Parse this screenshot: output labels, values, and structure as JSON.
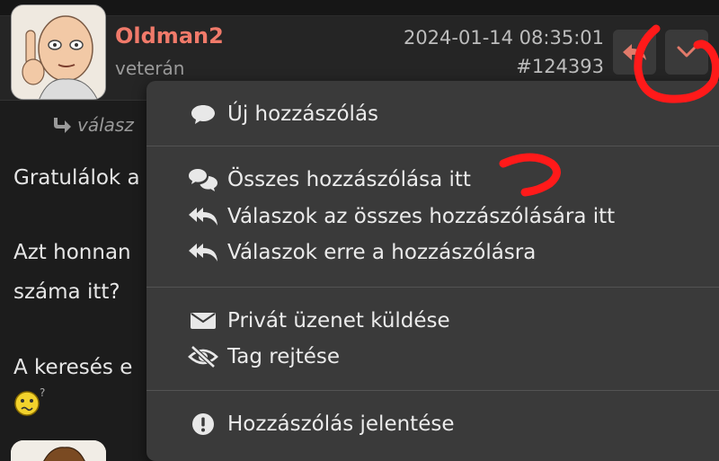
{
  "post": {
    "username": "Oldman2",
    "rank": "veterán",
    "date": "2024-01-14 08:35:01",
    "post_id": "#124393",
    "reply_label": "válasz",
    "body_lines": [
      "Gratulálok a",
      "Azt honnan",
      "száma itt?",
      "A keresés e"
    ],
    "emoji_suffix": "?"
  },
  "menu": {
    "new_post": "Új hozzászólás",
    "all_posts_here": "Összes hozzászólása itt",
    "replies_to_all": "Válaszok az összes hozzászólására itt",
    "replies_to_this": "Válaszok erre a hozzászólásra",
    "private_message": "Privát üzenet küldése",
    "hide_member": "Tag rejtése",
    "report_post": "Hozzászólás jelentése"
  },
  "colors": {
    "username": "#f07a6a",
    "menu_bg": "#3a3a3a",
    "annotation": "#ff1a1a"
  },
  "icons": [
    "reply-icon",
    "chevron-down-icon",
    "speech-bubble-icon",
    "comments-icon",
    "reply-all-icon",
    "envelope-icon",
    "eye-slash-icon",
    "exclamation-circle-icon"
  ]
}
